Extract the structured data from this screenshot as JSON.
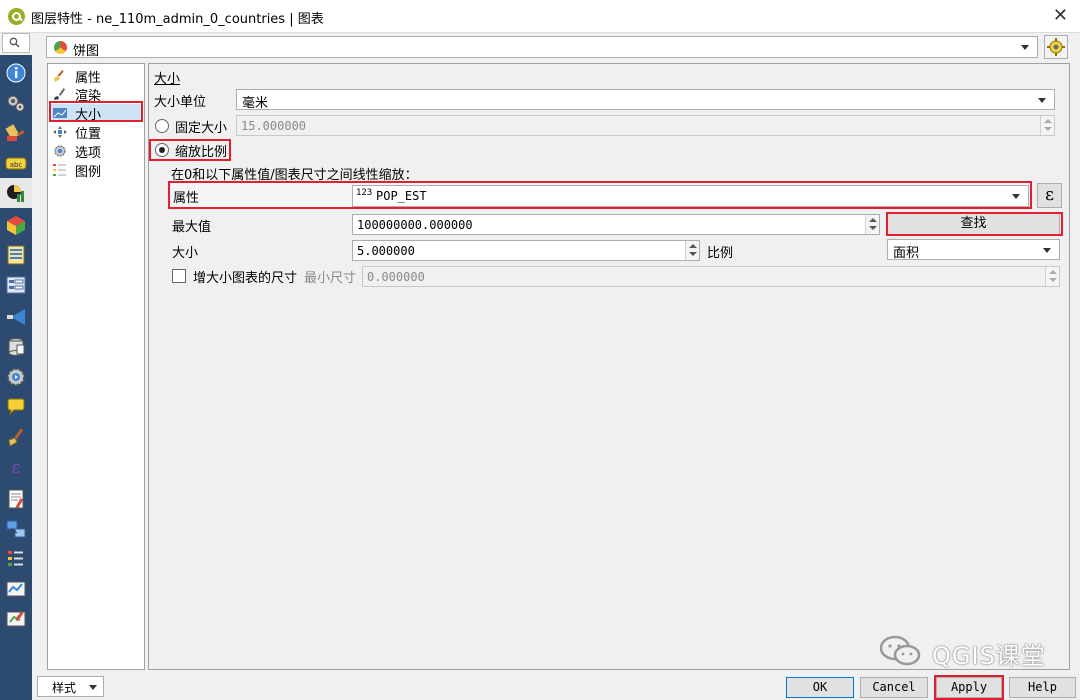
{
  "window": {
    "title": "图层特性 - ne_110m_admin_0_countries | 图表",
    "close": "✕"
  },
  "search": {
    "glyph": "🔍"
  },
  "diagram_type": {
    "value": "饼图"
  },
  "nav": {
    "items": [
      {
        "label": "属性"
      },
      {
        "label": "渲染"
      },
      {
        "label": "大小"
      },
      {
        "label": "位置"
      },
      {
        "label": "选项"
      },
      {
        "label": "图例"
      }
    ]
  },
  "size": {
    "section_title": "大小",
    "unit_label": "大小单位",
    "unit_value": "毫米",
    "fixed_label": "固定大小",
    "fixed_value": "15.000000",
    "scaled_label": "缩放比例",
    "scale_desc": "在0和以下属性值/图表尺寸之间线性缩放：",
    "attribute_label": "属性",
    "attribute_type": "123",
    "attribute_value": "POP_EST",
    "expression_glyph": "ε",
    "max_label": "最大值",
    "max_value": "100000000.000000",
    "find_button": "查找",
    "size_label": "大小",
    "size_value": "5.000000",
    "scale_label": "比例",
    "scale_value": "面积",
    "increase_label": "增大小图表的尺寸",
    "min_label": "最小尺寸",
    "min_value": "0.000000"
  },
  "footer": {
    "style_button": "样式",
    "ok": "OK",
    "cancel": "Cancel",
    "apply": "Apply",
    "help": "Help"
  },
  "watermark": {
    "text": "QGIS课堂"
  },
  "colors": {
    "highlight_border": "#e0202e",
    "toolbar_bg": "#2d4b70",
    "qgis_green": "#93b023"
  }
}
